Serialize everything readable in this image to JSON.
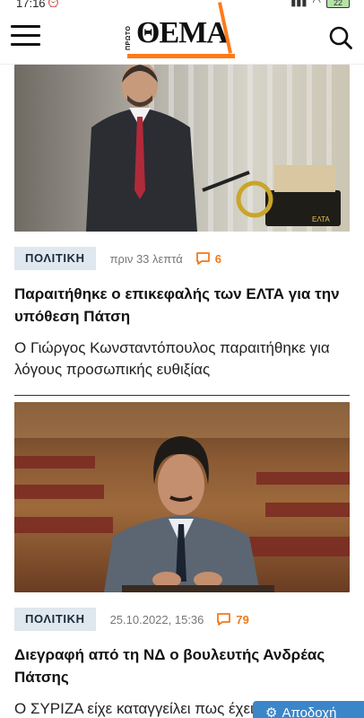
{
  "status_bar": {
    "time": "17:16",
    "battery": "22"
  },
  "header": {
    "logo_small": "ΠΡΩΤΟ",
    "logo": "ΘΕΜΑ"
  },
  "articles": [
    {
      "category": "ΠΟΛΙΤΙΚΗ",
      "time": "πριν 33 λεπτά",
      "comments": "6",
      "title": "Παραιτήθηκε ο επικεφαλής των ΕΛΤΑ για την υπόθεση Πάτση",
      "summary": "Ο Γιώργος Κωνσταντόπουλος παραιτήθηκε για λόγους προσωπικής ευθιξίας",
      "photo_sign": "ΕΛΤΑ"
    },
    {
      "category": "ΠΟΛΙΤΙΚΗ",
      "time": "25.10.2022, 15:36",
      "comments": "79",
      "title": "Διεγραφή από τη ΝΔ ο βουλευτής Ανδρέας Πάτσης",
      "summary": "Ο ΣΥΡΙΖΑ είχε καταγγείλει πως έχει επιχειρηματικές δραστηριότητες"
    }
  ],
  "consent": {
    "accept_label": "Αποδοχή"
  },
  "colors": {
    "accent": "#ff7a1a",
    "badge_bg": "#dfe7ef",
    "accept_bg": "#3b86c9"
  }
}
